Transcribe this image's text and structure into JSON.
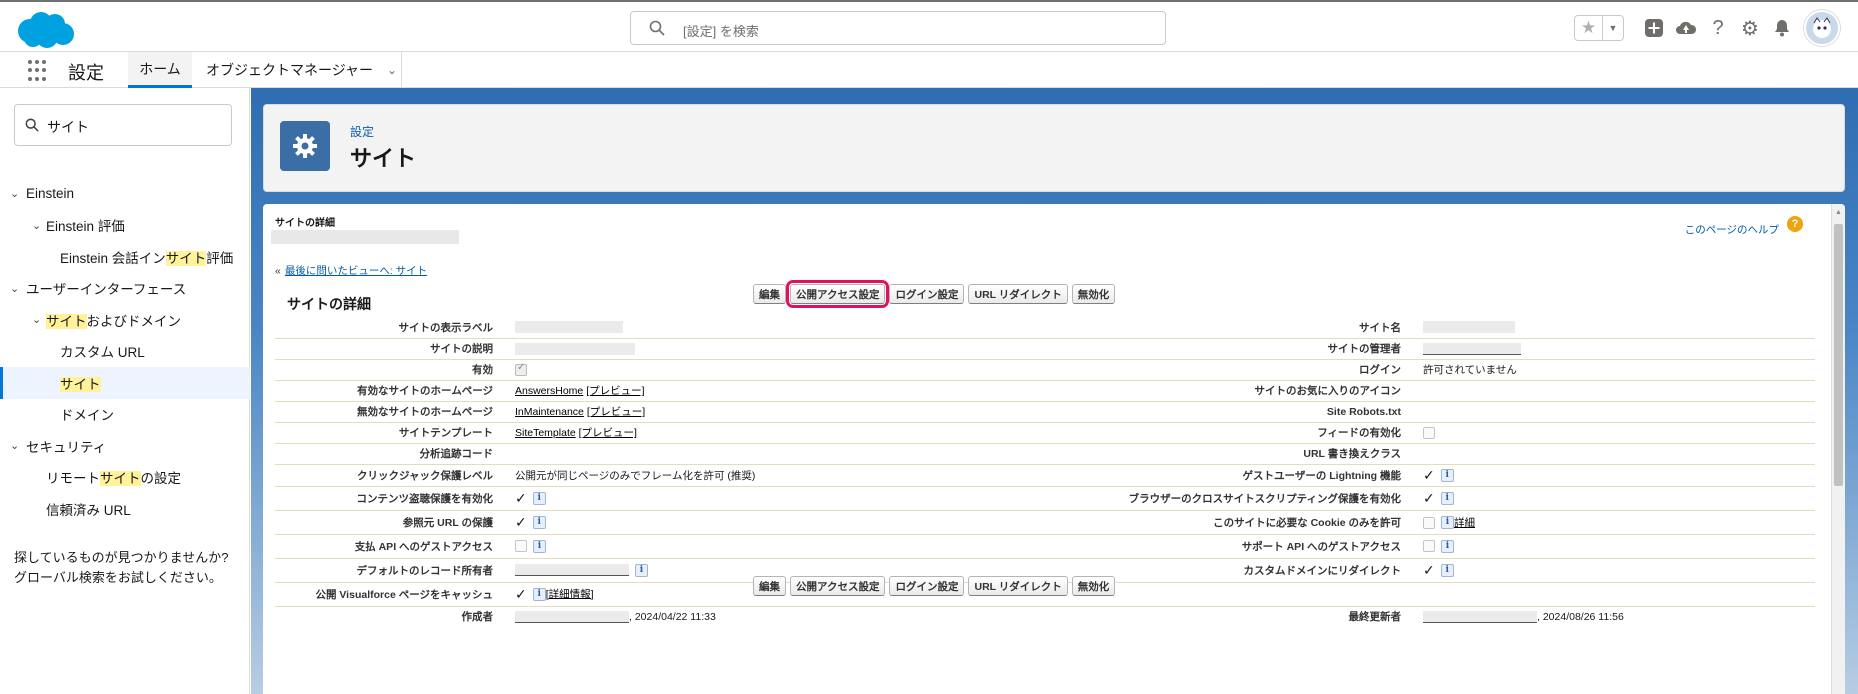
{
  "header": {
    "search_placeholder": "[設定] を検索"
  },
  "nav": {
    "app_name": "設定",
    "tabs": [
      {
        "label": "ホーム"
      },
      {
        "label": "オブジェクトマネージャー"
      }
    ]
  },
  "sidebar": {
    "quick_find_value": "サイト",
    "tree": [
      {
        "pre": "Einstein",
        "hl": "",
        "post": ""
      },
      {
        "pre": "Einstein 評価",
        "hl": "",
        "post": ""
      },
      {
        "pre": "Einstein 会話イン",
        "hl": "サイト",
        "post": "評価"
      },
      {
        "pre": "ユーザーインターフェース",
        "hl": "",
        "post": ""
      },
      {
        "pre": "",
        "hl": "サイト",
        "post": "およびドメイン"
      },
      {
        "pre": "カスタム URL",
        "hl": "",
        "post": ""
      },
      {
        "pre": "",
        "hl": "サイト",
        "post": ""
      },
      {
        "pre": "ドメイン",
        "hl": "",
        "post": ""
      },
      {
        "pre": "セキュリティ",
        "hl": "",
        "post": ""
      },
      {
        "pre": "リモート",
        "hl": "サイト",
        "post": "の設定"
      },
      {
        "pre": "信頼済み URL",
        "hl": "",
        "post": ""
      }
    ],
    "not_found_line1": "探しているものが見つかりませんか?",
    "not_found_line2": "グローバル検索をお試しください。"
  },
  "page_header": {
    "breadcrumb": "設定",
    "title": "サイト"
  },
  "detail": {
    "section_caption": "サイトの詳細",
    "help_link": "このページのヘルプ",
    "back_link": "最後に問いたビューへ: サイト",
    "title": "サイトの詳細",
    "buttons": {
      "edit": "編集",
      "public_access": "公開アクセス設定",
      "login": "ログイン設定",
      "url_redirect": "URL リダイレクト",
      "deactivate": "無効化"
    },
    "labels": {
      "display_label": "サイトの表示ラベル",
      "site_name": "サイト名",
      "description": "サイトの説明",
      "site_admin": "サイトの管理者",
      "active": "有効",
      "login": "ログイン",
      "active_home": "有効なサイトのホームページ",
      "favorite_icon": "サイトのお気に入りのアイコン",
      "inactive_home": "無効なサイトのホームページ",
      "robots": "Site Robots.txt",
      "template": "サイトテンプレート",
      "enable_feeds": "フィードの有効化",
      "analytics": "分析追跡コード",
      "url_rewriter": "URL 書き換えクラス",
      "clickjack": "クリックジャック保護レベル",
      "guest_lightning": "ゲストユーザーの Lightning 機能",
      "content_sniffing": "コンテンツ盗聴保護を有効化",
      "xss": "ブラウザーのクロスサイトスクリプティング保護を有効化",
      "referrer": "参照元 URL の保護",
      "cookie": "このサイトに必要な Cookie のみを許可",
      "payment_api": "支払 API へのゲストアクセス",
      "support_api": "サポート API へのゲストアクセス",
      "default_owner": "デフォルトのレコード所有者",
      "custom_domain_redirect": "カスタムドメインにリダイレクト",
      "vf_cache": "公開 Visualforce ページをキャッシュ",
      "created_by": "作成者",
      "modified_by": "最終更新者"
    },
    "values": {
      "login": "許可されていません",
      "active_home": "AnswersHome",
      "inactive_home": "InMaintenance",
      "template": "SiteTemplate",
      "preview": "[プレビュー]",
      "clickjack": "公開元が同じページのみでフレーム化を許可 (推奨)",
      "cookie_detail": "詳細",
      "vf_detail": "[詳細情報]",
      "created_date": ", 2024/04/22 11:33",
      "modified_date": ", 2024/08/26 11:56",
      "info_icon": "i"
    }
  }
}
